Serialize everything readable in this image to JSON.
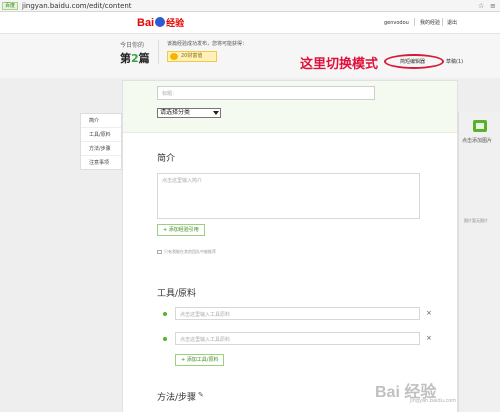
{
  "browser": {
    "site_badge": "百度",
    "url": "jingyan.baidu.com/edit/content",
    "tools": [
      "☆",
      "≡"
    ]
  },
  "header": {
    "logo_bai": "Bai",
    "logo_jy": "经验",
    "username": "genvodou",
    "my_jingyan": "我的经验",
    "logout": "退出"
  },
  "stats": {
    "today_label": "今日你的",
    "today_prefix": "第",
    "today_count": "2",
    "today_suffix": "篇",
    "earn_label": "该篇经验成功发布，您将可能获得：",
    "earn_badge": "20财富值"
  },
  "annotation": {
    "callout": "这里切换模式"
  },
  "toolbar": {
    "mode_switch": "简短编辑器",
    "drafts": "草稿(1)"
  },
  "form": {
    "title_placeholder": "标题：",
    "category_value": "请选择分类",
    "intro_title": "简介",
    "intro_placeholder": "点击这里输入简介",
    "add_ref": "+ 添加经验引用",
    "hint": "只有我能在其他团队中被推荐",
    "tools_title": "工具/原料",
    "tool_placeholder": "点击这里输入工具原料",
    "add_tool": "+ 添加工具/原料",
    "steps_title": "方法/步骤",
    "remove": "×"
  },
  "leftnav": {
    "items": [
      "简介",
      "工具/原料",
      "方法/步骤",
      "注意事项"
    ]
  },
  "rightpanel": {
    "add_image": "点击添加图片",
    "tip": "图片暂无图片"
  },
  "watermark": {
    "main": "Bai 经验",
    "sub": "jingyan.baidu.com"
  },
  "colors": {
    "brand_red": "#e10601",
    "accent_green": "#58b32b",
    "callout_red": "#e0103a"
  }
}
